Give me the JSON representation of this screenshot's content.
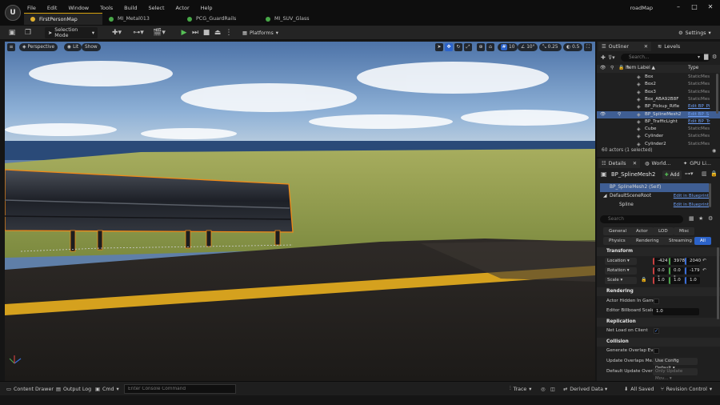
{
  "menu": [
    "File",
    "Edit",
    "Window",
    "Tools",
    "Build",
    "Select",
    "Actor",
    "Help"
  ],
  "project_name": "roadMap",
  "doc_tabs": [
    {
      "label": "FirstPersonMap",
      "color": "#e0b030"
    },
    {
      "label": "MI_Metal013",
      "color": "#48a848"
    },
    {
      "label": "PCG_GuardRails",
      "color": "#48a848"
    },
    {
      "label": "MI_SUV_Glass",
      "color": "#48a848"
    }
  ],
  "toolbar": {
    "selection_mode": "Selection Mode",
    "platforms": "Platforms",
    "settings": "Settings"
  },
  "viewport": {
    "perspective": "Perspective",
    "lit": "Lit",
    "show": "Show",
    "grid_snap": "10",
    "rotation_snap": "10°",
    "scale_snap": "0.25",
    "camera_speed": "0.5"
  },
  "bottom": {
    "content_drawer": "Content Drawer",
    "output_log": "Output Log",
    "cmd": "Cmd",
    "console_placeholder": "Enter Console Command",
    "trace": "Trace",
    "derived_data": "Derived Data",
    "all_saved": "All Saved",
    "revision_control": "Revision Control"
  },
  "outliner": {
    "tab": "Outliner",
    "levels_tab": "Levels",
    "search_placeholder": "Search...",
    "col_label": "Item Label ▲",
    "col_type": "Type",
    "rows": [
      {
        "label": "Box",
        "type": "StaticMes",
        "link": false,
        "selected": false
      },
      {
        "label": "Box2",
        "type": "StaticMes",
        "link": false,
        "selected": false
      },
      {
        "label": "Box3",
        "type": "StaticMes",
        "link": false,
        "selected": false
      },
      {
        "label": "Box_ABA92B8F",
        "type": "StaticMes",
        "link": false,
        "selected": false
      },
      {
        "label": "BP_Pickup_Rifle",
        "type": "Edit BP_Pi",
        "link": true,
        "selected": false
      },
      {
        "label": "BP_SplineMesh2",
        "type": "Edit BP_S",
        "link": true,
        "selected": true
      },
      {
        "label": "BP_TrafficLight",
        "type": "Edit BP_Tr",
        "link": true,
        "selected": false
      },
      {
        "label": "Cube",
        "type": "StaticMes",
        "link": false,
        "selected": false
      },
      {
        "label": "Cylinder",
        "type": "StaticMes",
        "link": false,
        "selected": false
      },
      {
        "label": "Cylinder2",
        "type": "StaticMes",
        "link": false,
        "selected": false
      }
    ],
    "actor_count": "60 actors (1 selected)"
  },
  "details": {
    "tab": "Details",
    "world_tab": "World...",
    "gpu_tab": "GPU Li...",
    "actor_name": "BP_SplineMesh2",
    "add_label": "Add",
    "components": [
      {
        "label": "BP_SplineMesh2 (Self)",
        "edit": ""
      },
      {
        "label": "DefaultSceneRoot",
        "edit": "Edit in Blueprint"
      },
      {
        "label": "Spline",
        "edit": "Edit in Blueprint"
      }
    ],
    "search_placeholder": "Search",
    "categories_row1": [
      "General",
      "Actor",
      "LOD",
      "Misc"
    ],
    "categories_row2": [
      "Physics",
      "Rendering",
      "Streaming",
      "All"
    ],
    "transform": {
      "title": "Transform",
      "location_label": "Location",
      "location": [
        "-424",
        "3978",
        "2040"
      ],
      "rotation_label": "Rotation",
      "rotation": [
        "0.0 °",
        "0.0 °",
        "-179"
      ],
      "scale_label": "Scale",
      "scale": [
        "1.0",
        "1.0",
        "1.0"
      ]
    },
    "rendering": {
      "title": "Rendering",
      "hidden_label": "Actor Hidden In Game",
      "billboard_label": "Editor Billboard Scale",
      "billboard_value": "1.0"
    },
    "replication": {
      "title": "Replication",
      "net_load_label": "Net Load on Client"
    },
    "collision": {
      "title": "Collision",
      "overlap_label": "Generate Overlap Ev...",
      "update_label": "Update Overlaps Me...",
      "update_value": "Use Config Default",
      "default_update_label": "Default Update Overl...",
      "default_update_value": "Only Update Mov..."
    }
  }
}
